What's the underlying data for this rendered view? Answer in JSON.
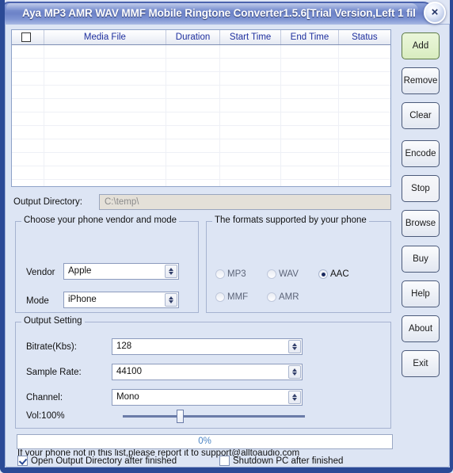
{
  "window": {
    "title": "Aya MP3 AMR WAV MMF Mobile Ringtone Converter1.5.6[Trial Version,Left 1 fil",
    "close_label": "×"
  },
  "file_list": {
    "columns": [
      "",
      "Media File",
      "Duration",
      "Start Time",
      "End Time",
      "Status"
    ],
    "rows": []
  },
  "side_buttons": [
    {
      "label": "Add",
      "accent": true
    },
    {
      "label": "Remove",
      "accent": false
    },
    {
      "label": "Clear",
      "accent": false
    },
    {
      "label": "Encode",
      "accent": false
    },
    {
      "label": "Stop",
      "accent": false
    },
    {
      "label": "Browse",
      "accent": false
    },
    {
      "label": "Buy",
      "accent": false
    },
    {
      "label": "Help",
      "accent": false
    },
    {
      "label": "About",
      "accent": false
    },
    {
      "label": "Exit",
      "accent": false
    }
  ],
  "output_directory": {
    "label": "Output Directory:",
    "value": "C:\\temp\\",
    "placeholder": "C:\\temp\\"
  },
  "vendor_group": {
    "title": "Choose your phone vendor and mode",
    "vendor_label": "Vendor",
    "vendor_value": "Apple",
    "mode_label": "Mode",
    "mode_value": "iPhone"
  },
  "formats_group": {
    "title": "The formats supported by your phone",
    "options": [
      {
        "label": "MP3",
        "selected": false
      },
      {
        "label": "WAV",
        "selected": false
      },
      {
        "label": "AAC",
        "selected": true
      },
      {
        "label": "MMF",
        "selected": false
      },
      {
        "label": "AMR",
        "selected": false
      }
    ]
  },
  "output_setting": {
    "title": "Output Setting",
    "bitrate_label": "Bitrate(Kbs):",
    "bitrate_value": "128",
    "samplerate_label": "Sample Rate:",
    "samplerate_value": "44100",
    "channel_label": "Channel:",
    "channel_value": "Mono",
    "volume_label": "Vol:100%",
    "volume_percent": 100
  },
  "progress": {
    "percent": 0,
    "text": "0%"
  },
  "bottom_options": {
    "open_dir_label": "Open Output Directory after finished",
    "open_dir_checked": true,
    "shutdown_label": "Shutdown PC after finished",
    "shutdown_checked": false
  },
  "footnote": "If your phone not in this list,please report it to support@alltoaudio.com",
  "colors": {
    "accent_button": "#e2f2cd",
    "title_bar": "#6d83c8",
    "frame_border": "#2b4a96",
    "header_text": "#1e2f9e",
    "progress_text": "#4b84c4"
  }
}
